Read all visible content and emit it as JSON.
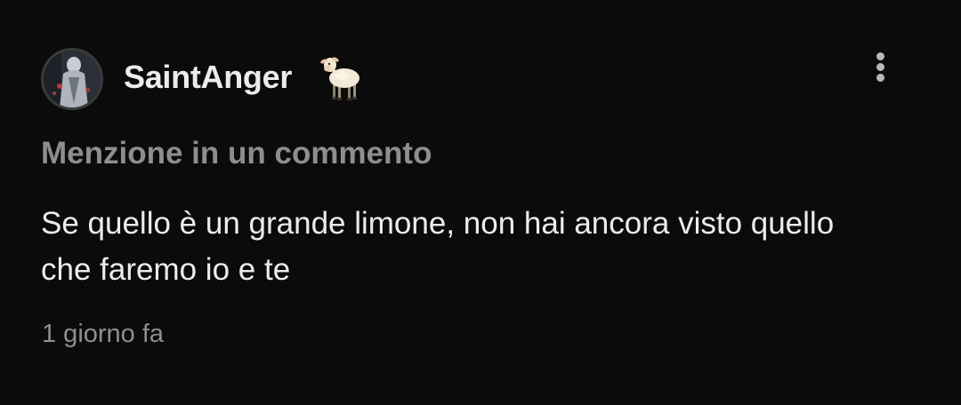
{
  "notification": {
    "username": "SaintAnger",
    "badge_icon": "lamb-icon",
    "context": "Menzione in un commento",
    "message_lines": [
      "Se quello è un grande limone, non hai ancora visto quello",
      "che faremo io e te"
    ],
    "timestamp": "1 giorno fa"
  },
  "colors": {
    "background": "#0b0b0b",
    "primary_text": "#ececec",
    "secondary_text": "#8e8e8e"
  }
}
